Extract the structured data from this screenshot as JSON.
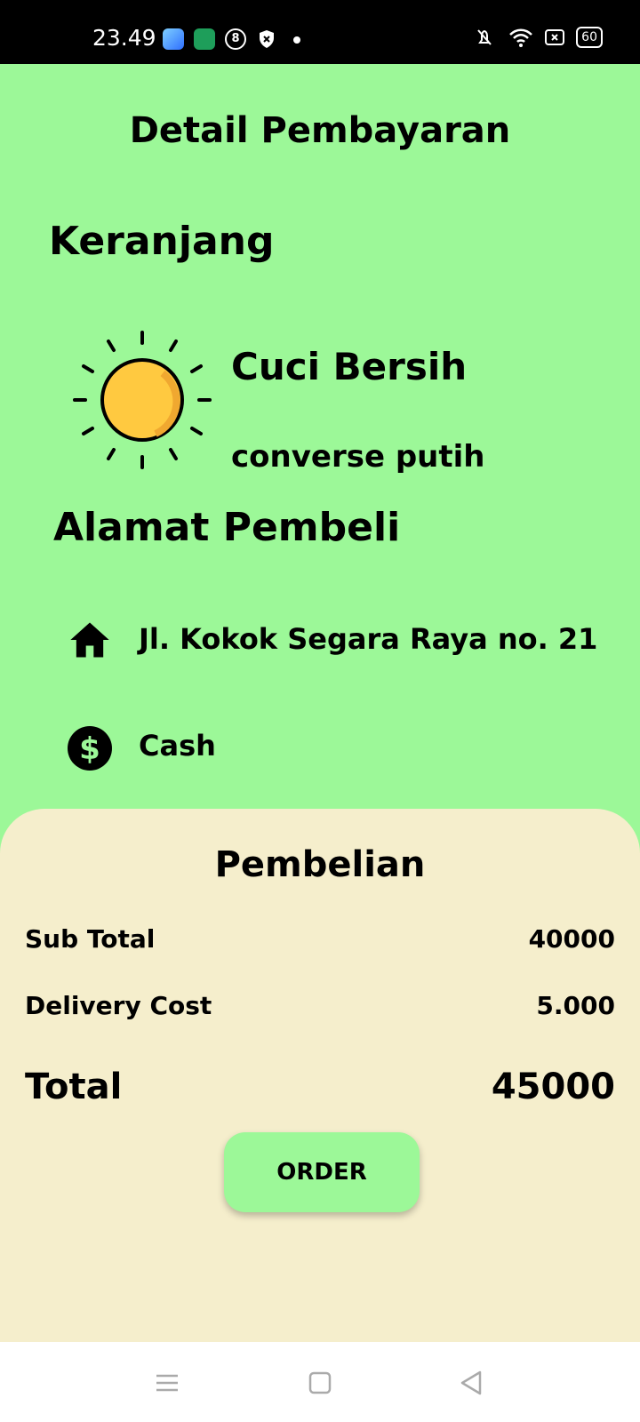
{
  "status_bar": {
    "time": "23.49",
    "app_icon_label": "8",
    "battery": "60"
  },
  "header": {
    "title": "Detail Pembayaran"
  },
  "cart": {
    "section_title": "Keranjang",
    "item": {
      "icon": "sun-icon",
      "name": "Cuci Bersih",
      "description": "converse putih"
    }
  },
  "address": {
    "section_title": "Alamat Pembeli",
    "street": "Jl. Kokok Segara Raya no. 21",
    "payment_method": "Cash"
  },
  "summary": {
    "title": "Pembelian",
    "sub_total_label": "Sub Total",
    "sub_total_value": "40000",
    "delivery_label": "Delivery Cost",
    "delivery_value": "5.000",
    "total_label": "Total",
    "total_value": "45000",
    "order_label": "ORDER"
  },
  "colors": {
    "background": "#9cf898",
    "summary_panel": "#f5eecc",
    "button": "#9cf898"
  }
}
